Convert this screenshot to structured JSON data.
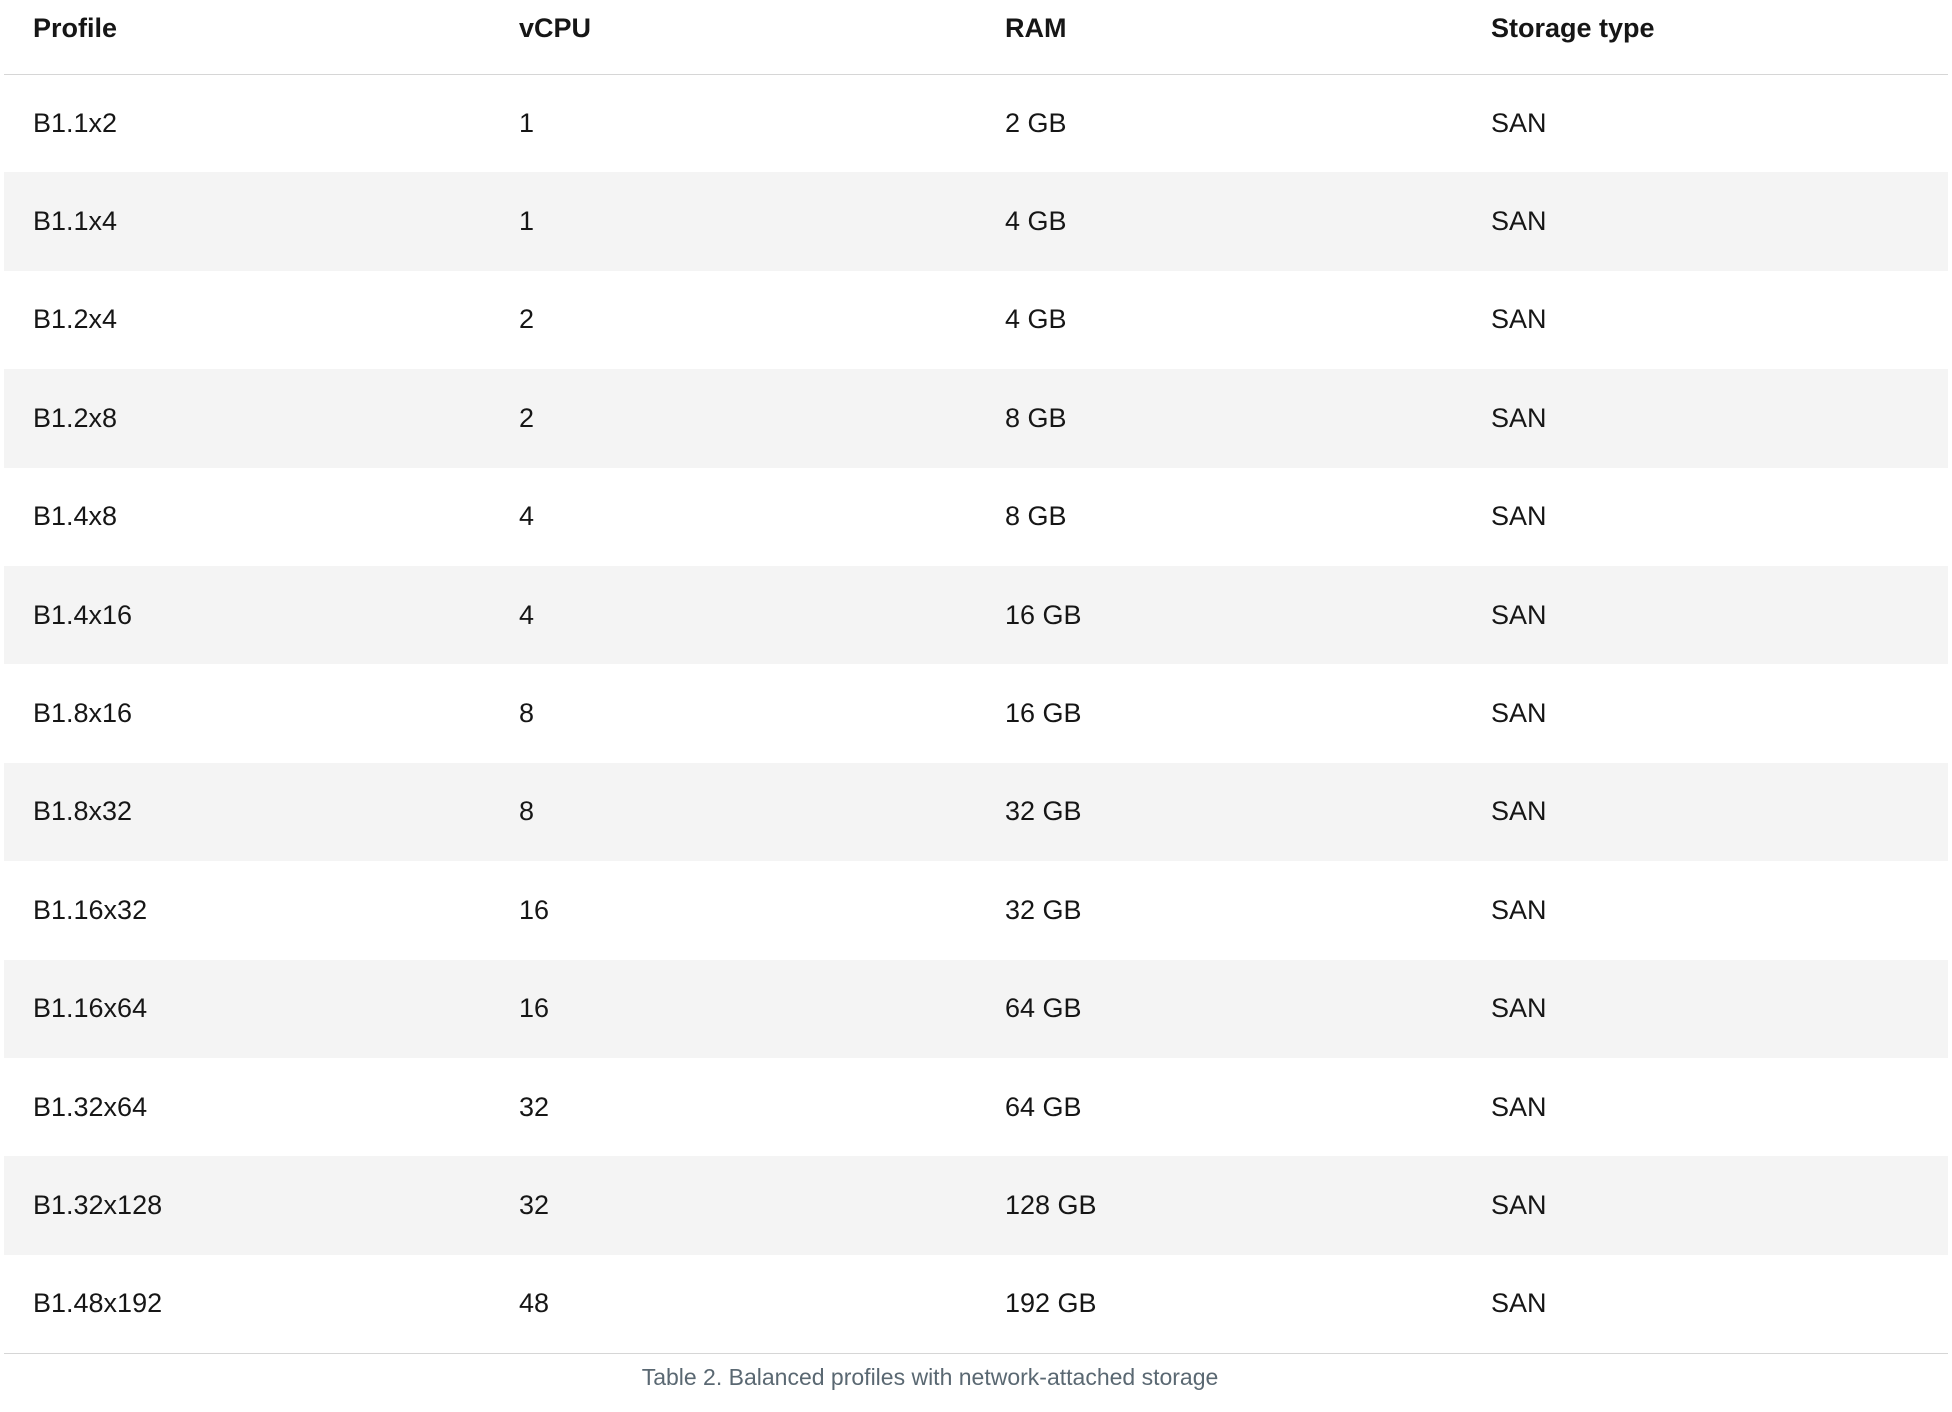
{
  "table": {
    "headers": [
      "Profile",
      "vCPU",
      "RAM",
      "Storage type"
    ],
    "rows": [
      [
        "B1.1x2",
        "1",
        "2 GB",
        "SAN"
      ],
      [
        "B1.1x4",
        "1",
        "4 GB",
        "SAN"
      ],
      [
        "B1.2x4",
        "2",
        "4 GB",
        "SAN"
      ],
      [
        "B1.2x8",
        "2",
        "8 GB",
        "SAN"
      ],
      [
        "B1.4x8",
        "4",
        "8 GB",
        "SAN"
      ],
      [
        "B1.4x16",
        "4",
        "16 GB",
        "SAN"
      ],
      [
        "B1.8x16",
        "8",
        "16 GB",
        "SAN"
      ],
      [
        "B1.8x32",
        "8",
        "32 GB",
        "SAN"
      ],
      [
        "B1.16x32",
        "16",
        "32 GB",
        "SAN"
      ],
      [
        "B1.16x64",
        "16",
        "64 GB",
        "SAN"
      ],
      [
        "B1.32x64",
        "32",
        "64 GB",
        "SAN"
      ],
      [
        "B1.32x128",
        "32",
        "128 GB",
        "SAN"
      ],
      [
        "B1.48x192",
        "48",
        "192 GB",
        "SAN"
      ]
    ],
    "caption": "Table 2. Balanced profiles with network-attached storage"
  },
  "colors": {
    "stripe": "#f4f4f4",
    "border": "#d6d6d6",
    "caption_text": "#5a6872",
    "text": "#161616"
  }
}
